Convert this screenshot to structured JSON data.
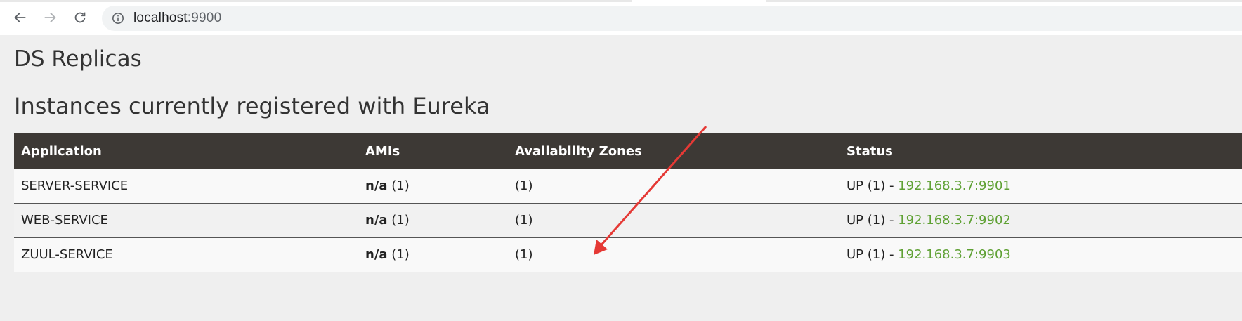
{
  "browser": {
    "url_host": "localhost",
    "url_port": ":9900"
  },
  "page": {
    "title": "DS Replicas",
    "subtitle": "Instances currently registered with Eureka"
  },
  "table": {
    "headers": {
      "application": "Application",
      "amis": "AMIs",
      "zones": "Availability Zones",
      "status": "Status"
    },
    "rows": [
      {
        "application": "SERVER-SERVICE",
        "ami": "n/a",
        "ami_count": "(1)",
        "zones": "(1)",
        "status": "UP (1) - ",
        "instance": "192.168.3.7:9901"
      },
      {
        "application": "WEB-SERVICE",
        "ami": "n/a",
        "ami_count": "(1)",
        "zones": "(1)",
        "status": "UP (1) - ",
        "instance": "192.168.3.7:9902"
      },
      {
        "application": "ZUUL-SERVICE",
        "ami": "n/a",
        "ami_count": "(1)",
        "zones": "(1)",
        "status": "UP (1) - ",
        "instance": "192.168.3.7:9903"
      }
    ]
  },
  "colors": {
    "header_bg": "#3d3935",
    "link": "#5fa134",
    "annotation_arrow": "#e53935"
  }
}
